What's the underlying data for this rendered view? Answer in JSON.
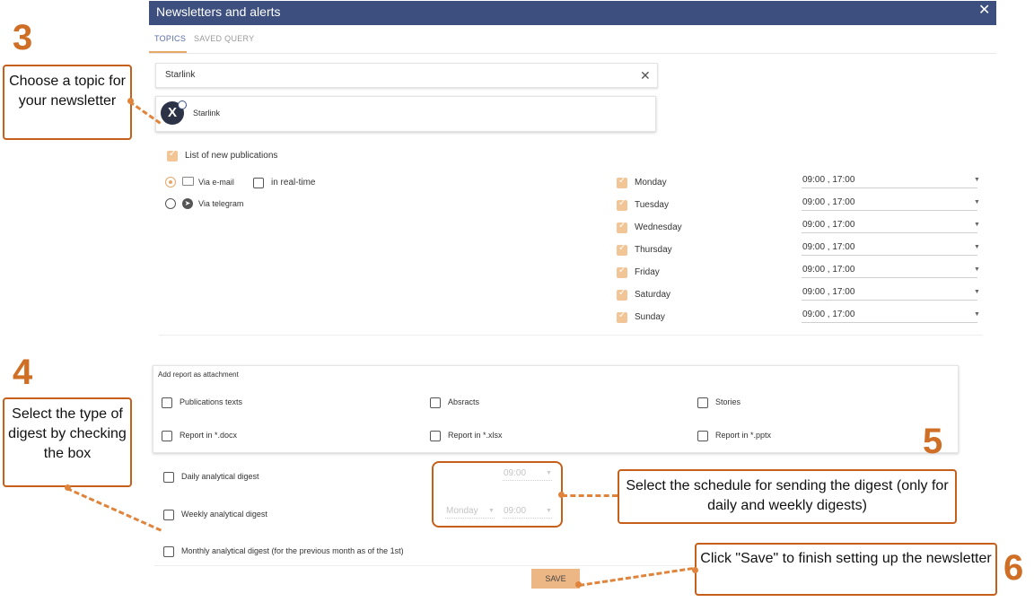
{
  "dialog": {
    "title": "Newsletters and alerts",
    "close_icon": "✕"
  },
  "tabs": [
    {
      "label": "TOPICS",
      "active": true
    },
    {
      "label": "SAVED QUERY",
      "active": false
    }
  ],
  "search": {
    "value": "Starlink",
    "clear_icon": "✕"
  },
  "topic": {
    "name": "Starlink",
    "logo_glyph": "X"
  },
  "new_publications": {
    "label": "List of new publications",
    "checked": true
  },
  "delivery": {
    "via_email": "Via e-mail",
    "via_telegram": "Via telegram",
    "realtime": "in real-time"
  },
  "days": [
    {
      "label": "Monday",
      "times": "09:00 , 17:00"
    },
    {
      "label": "Tuesday",
      "times": "09:00 , 17:00"
    },
    {
      "label": "Wednesday",
      "times": "09:00 , 17:00"
    },
    {
      "label": "Thursday",
      "times": "09:00 , 17:00"
    },
    {
      "label": "Friday",
      "times": "09:00 , 17:00"
    },
    {
      "label": "Saturday",
      "times": "09:00 , 17:00"
    },
    {
      "label": "Sunday",
      "times": "09:00 , 17:00"
    }
  ],
  "attachment": {
    "title": "Add report as attachment",
    "options": [
      "Publications texts",
      "Absracts",
      "Stories",
      "Report in *.docx",
      "Report in *.xlsx",
      "Report in *.pptx"
    ]
  },
  "digests": {
    "daily": "Daily analytical digest",
    "weekly": "Weekly analytical digest",
    "monthly": "Monthly analytical digest (for the previous month as of the 1st)",
    "daily_time": "09:00",
    "weekly_day": "Monday",
    "weekly_time": "09:00"
  },
  "save_label": "SAVE",
  "annotations": {
    "n3": "3",
    "n4": "4",
    "n5": "5",
    "n6": "6",
    "a3": "Choose a topic for your newsletter",
    "a4": "Select the type of digest by checking the box",
    "a5": "Select the schedule for sending the digest (only for daily and weekly digests)",
    "a6": "Click \"Save\" to finish setting up the newsletter"
  },
  "colors": {
    "header": "#3c4f7f",
    "accent": "#e8a86a",
    "annotation": "#c55f1a"
  }
}
